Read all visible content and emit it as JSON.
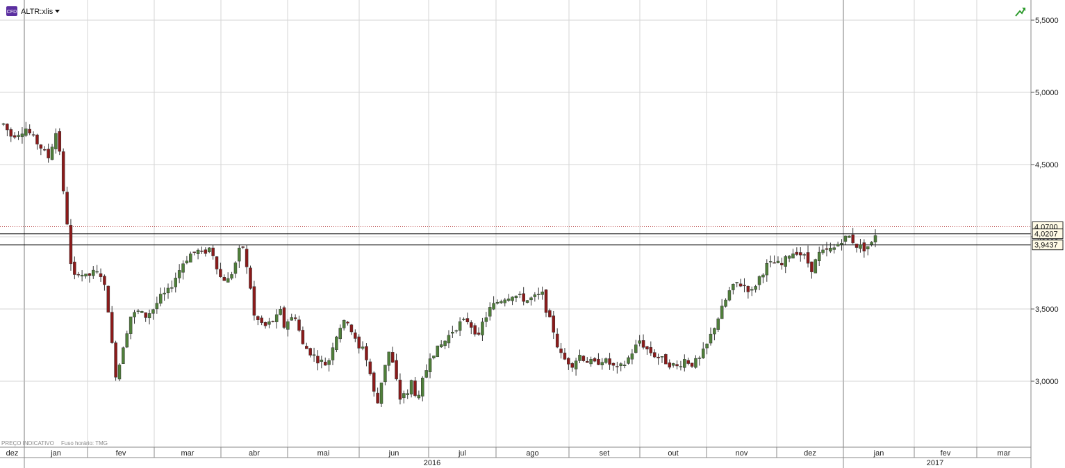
{
  "header": {
    "badge": "CFD",
    "symbol": "ALTR:xlis"
  },
  "footer": {
    "note": "PREÇO INDICATIVO",
    "timezone": "Fuso horário: TMG"
  },
  "colors": {
    "up": "#4f7f3a",
    "down": "#8b1a1a",
    "grid": "#d6d6d6",
    "accent": "#2e9b2e",
    "badge": "#5b2fa0"
  },
  "chart_data": {
    "type": "candlestick",
    "y_axis": {
      "min": 2.8,
      "max": 5.55,
      "ticks": [
        3.0,
        3.5,
        4.0,
        4.5,
        5.0,
        5.5
      ],
      "tick_labels": [
        "3,0000",
        "3,5000",
        "4,0000",
        "4,5000",
        "5,0000",
        "5,5000"
      ],
      "grid": true
    },
    "x_axis": {
      "months": [
        "dez",
        "jan",
        "fev",
        "mar",
        "abr",
        "mai",
        "jun",
        "jul",
        "ago",
        "set",
        "out",
        "nov",
        "dez",
        "jan",
        "fev",
        "mar"
      ],
      "years": [
        "2016",
        "2017"
      ],
      "grid": true
    },
    "reference_lines": [
      {
        "value": 4.07,
        "label": "4,0700",
        "style": "dotted",
        "color": "#b03030"
      },
      {
        "value": 4.0207,
        "label": "4,0207",
        "style": "solid",
        "color": "#000000"
      },
      {
        "value": 3.9437,
        "label": "3,9437",
        "style": "solid",
        "color": "#000000"
      }
    ],
    "trend": [
      [
        0,
        4.78
      ],
      [
        2,
        4.7
      ],
      [
        4,
        4.72
      ],
      [
        6,
        4.75
      ],
      [
        8,
        4.68
      ],
      [
        10,
        4.62
      ],
      [
        12,
        4.55
      ],
      [
        14,
        4.72
      ],
      [
        15,
        4.6
      ],
      [
        16,
        4.3
      ],
      [
        17,
        4.1
      ],
      [
        18,
        3.8
      ],
      [
        19,
        3.72
      ],
      [
        20,
        3.76
      ],
      [
        22,
        3.72
      ],
      [
        24,
        3.75
      ],
      [
        26,
        3.74
      ],
      [
        27,
        3.65
      ],
      [
        28,
        3.5
      ],
      [
        29,
        3.25
      ],
      [
        30,
        3.05
      ],
      [
        31,
        3.12
      ],
      [
        32,
        3.25
      ],
      [
        34,
        3.45
      ],
      [
        36,
        3.48
      ],
      [
        38,
        3.45
      ],
      [
        40,
        3.5
      ],
      [
        42,
        3.58
      ],
      [
        44,
        3.62
      ],
      [
        46,
        3.72
      ],
      [
        48,
        3.82
      ],
      [
        50,
        3.88
      ],
      [
        52,
        3.9
      ],
      [
        53,
        3.88
      ],
      [
        55,
        3.92
      ],
      [
        56,
        3.88
      ],
      [
        57,
        3.8
      ],
      [
        58,
        3.72
      ],
      [
        60,
        3.7
      ],
      [
        61,
        3.75
      ],
      [
        62,
        3.82
      ],
      [
        63,
        3.9
      ],
      [
        64,
        3.93
      ],
      [
        65,
        3.78
      ],
      [
        66,
        3.65
      ],
      [
        67,
        3.45
      ],
      [
        68,
        3.42
      ],
      [
        70,
        3.38
      ],
      [
        72,
        3.42
      ],
      [
        73,
        3.44
      ],
      [
        74,
        3.48
      ],
      [
        75,
        3.38
      ],
      [
        76,
        3.42
      ],
      [
        78,
        3.45
      ],
      [
        79,
        3.35
      ],
      [
        80,
        3.25
      ],
      [
        82,
        3.2
      ],
      [
        84,
        3.15
      ],
      [
        86,
        3.12
      ],
      [
        87,
        3.15
      ],
      [
        88,
        3.25
      ],
      [
        89,
        3.32
      ],
      [
        90,
        3.38
      ],
      [
        92,
        3.42
      ],
      [
        93,
        3.35
      ],
      [
        94,
        3.28
      ],
      [
        95,
        3.22
      ],
      [
        96,
        3.25
      ],
      [
        97,
        3.15
      ],
      [
        98,
        3.05
      ],
      [
        99,
        2.92
      ],
      [
        100,
        2.85
      ],
      [
        101,
        3.0
      ],
      [
        102,
        3.12
      ],
      [
        103,
        3.2
      ],
      [
        104,
        3.12
      ],
      [
        105,
        3.0
      ],
      [
        106,
        2.88
      ],
      [
        107,
        2.92
      ],
      [
        108,
        2.9
      ],
      [
        109,
        3.0
      ],
      [
        110,
        2.92
      ],
      [
        111,
        2.88
      ],
      [
        112,
        3.0
      ],
      [
        113,
        3.08
      ],
      [
        114,
        3.18
      ],
      [
        115,
        3.2
      ],
      [
        116,
        3.22
      ],
      [
        118,
        3.28
      ],
      [
        120,
        3.35
      ],
      [
        122,
        3.4
      ],
      [
        124,
        3.42
      ],
      [
        126,
        3.35
      ],
      [
        127,
        3.3
      ],
      [
        128,
        3.4
      ],
      [
        130,
        3.5
      ],
      [
        132,
        3.55
      ],
      [
        134,
        3.58
      ],
      [
        136,
        3.6
      ],
      [
        138,
        3.58
      ],
      [
        140,
        3.56
      ],
      [
        142,
        3.58
      ],
      [
        144,
        3.6
      ],
      [
        145,
        3.5
      ],
      [
        146,
        3.42
      ],
      [
        147,
        3.35
      ],
      [
        148,
        3.25
      ],
      [
        149,
        3.18
      ],
      [
        150,
        3.15
      ],
      [
        152,
        3.12
      ],
      [
        154,
        3.18
      ],
      [
        156,
        3.14
      ],
      [
        158,
        3.12
      ],
      [
        160,
        3.15
      ],
      [
        162,
        3.12
      ],
      [
        164,
        3.08
      ],
      [
        166,
        3.12
      ],
      [
        168,
        3.2
      ],
      [
        170,
        3.28
      ],
      [
        172,
        3.22
      ],
      [
        174,
        3.18
      ],
      [
        176,
        3.15
      ],
      [
        178,
        3.12
      ],
      [
        180,
        3.1
      ],
      [
        182,
        3.15
      ],
      [
        184,
        3.12
      ],
      [
        186,
        3.15
      ],
      [
        188,
        3.25
      ],
      [
        190,
        3.38
      ],
      [
        192,
        3.5
      ],
      [
        194,
        3.62
      ],
      [
        196,
        3.68
      ],
      [
        198,
        3.66
      ],
      [
        200,
        3.62
      ],
      [
        202,
        3.72
      ],
      [
        204,
        3.8
      ],
      [
        206,
        3.82
      ],
      [
        208,
        3.8
      ],
      [
        210,
        3.88
      ],
      [
        212,
        3.9
      ],
      [
        214,
        3.86
      ],
      [
        216,
        3.78
      ],
      [
        218,
        3.88
      ],
      [
        220,
        3.9
      ],
      [
        222,
        3.92
      ],
      [
        224,
        3.98
      ],
      [
        226,
        4.0
      ],
      [
        228,
        3.94
      ],
      [
        230,
        3.92
      ],
      [
        232,
        3.95
      ],
      [
        233,
        4.02
      ]
    ],
    "total_bars": 234
  }
}
